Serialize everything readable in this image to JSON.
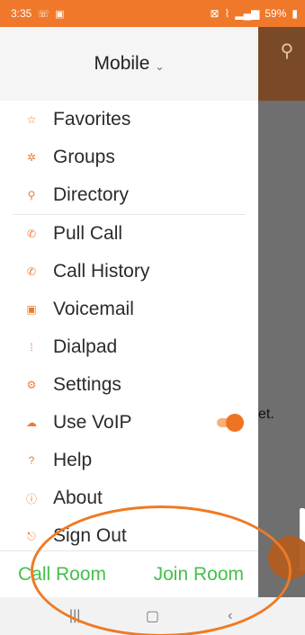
{
  "status_bar": {
    "time": "3:35",
    "battery": "59%",
    "left_icons": [
      "call-forward-icon",
      "image-icon"
    ],
    "right_icons": [
      "vibrate-icon",
      "wifi-icon",
      "signal-icon",
      "battery-icon"
    ]
  },
  "drawer": {
    "account": {
      "label": "Mobile",
      "chevron": "⌄"
    },
    "menu_items": [
      {
        "label": "Favorites",
        "icon": "star-icon"
      },
      {
        "label": "Groups",
        "icon": "groups-icon"
      },
      {
        "label": "Directory",
        "icon": "search-icon"
      },
      {
        "label": "Pull Call",
        "icon": "phone-icon"
      },
      {
        "label": "Call History",
        "icon": "phone-history-icon"
      },
      {
        "label": "Voicemail",
        "icon": "voicemail-icon"
      },
      {
        "label": "Dialpad",
        "icon": "dialpad-icon"
      },
      {
        "label": "Settings",
        "icon": "gear-icon"
      },
      {
        "label": "Use VoIP",
        "icon": "cloud-icon",
        "toggle_on": true
      },
      {
        "label": "Help",
        "icon": "help-icon"
      },
      {
        "label": "About",
        "icon": "info-icon"
      },
      {
        "label": "Sign Out",
        "icon": "sign-out-icon"
      }
    ],
    "bottom_actions": {
      "call_room": "Call Room",
      "join_room": "Join Room"
    }
  },
  "background": {
    "partial_text": "et."
  },
  "colors": {
    "accent": "#f0782a",
    "action_green": "#45c04a",
    "toggle_on": "#ee7424"
  }
}
